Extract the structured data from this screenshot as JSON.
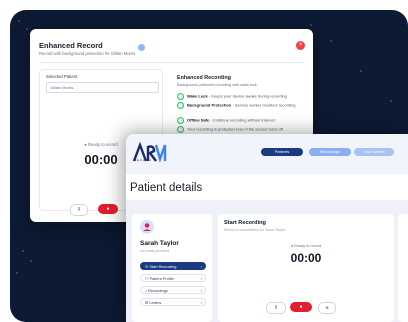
{
  "enhanced_record": {
    "title": "Enhanced Record",
    "subtitle": "Record with background protection for Gillian Morris",
    "close_icon": "close-icon",
    "selected_patient_label": "Selected Patient",
    "selected_patient_value": "Gillian Morris",
    "ready_text": "● Ready to record",
    "timer": "00:00",
    "pause_glyph": "II",
    "record_glyph": "●",
    "features_title": "Enhanced Recording",
    "features_subtitle": "Background-protected recording with wake lock",
    "features": [
      {
        "name": "Wake Lock",
        "desc": " - Keeps your device awake during recording"
      },
      {
        "name": "Background Protection",
        "desc": " - Service worker monitors recording"
      },
      {
        "name": "Offline Safe",
        "desc": " - Continue recording without internet"
      },
      {
        "name": "",
        "desc": "Your recording is protected even if the screen turns off"
      }
    ]
  },
  "app": {
    "logo_text": "ARVI",
    "logo_sub": "HEALTH",
    "nav": {
      "patients": "Patients",
      "recordings": "Recordings",
      "letters": "Your Letters"
    },
    "page_title": "Patient details",
    "patient": {
      "name": "Sarah Taylor",
      "email": "No email provided"
    },
    "menu": [
      {
        "label": "Start Recording",
        "icon": "record-icon",
        "active": true
      },
      {
        "label": "Patient Profile",
        "icon": "user-icon",
        "active": false
      },
      {
        "label": "Recordings",
        "icon": "mic-icon",
        "active": false
      },
      {
        "label": "Letters",
        "icon": "letter-icon",
        "active": false
      }
    ],
    "start_recording": {
      "title": "Start Recording",
      "subtitle": "Record a consultation for Sarah Taylor",
      "ready_text": "● Ready to record",
      "timer": "00:00",
      "pause_glyph": "II",
      "record_glyph": "●",
      "stop_glyph": "■"
    }
  },
  "colors": {
    "background": "#0c1a33",
    "brand_navy": "#1c3a82",
    "record_red": "#e11d2e",
    "success_green": "#22c55e"
  }
}
